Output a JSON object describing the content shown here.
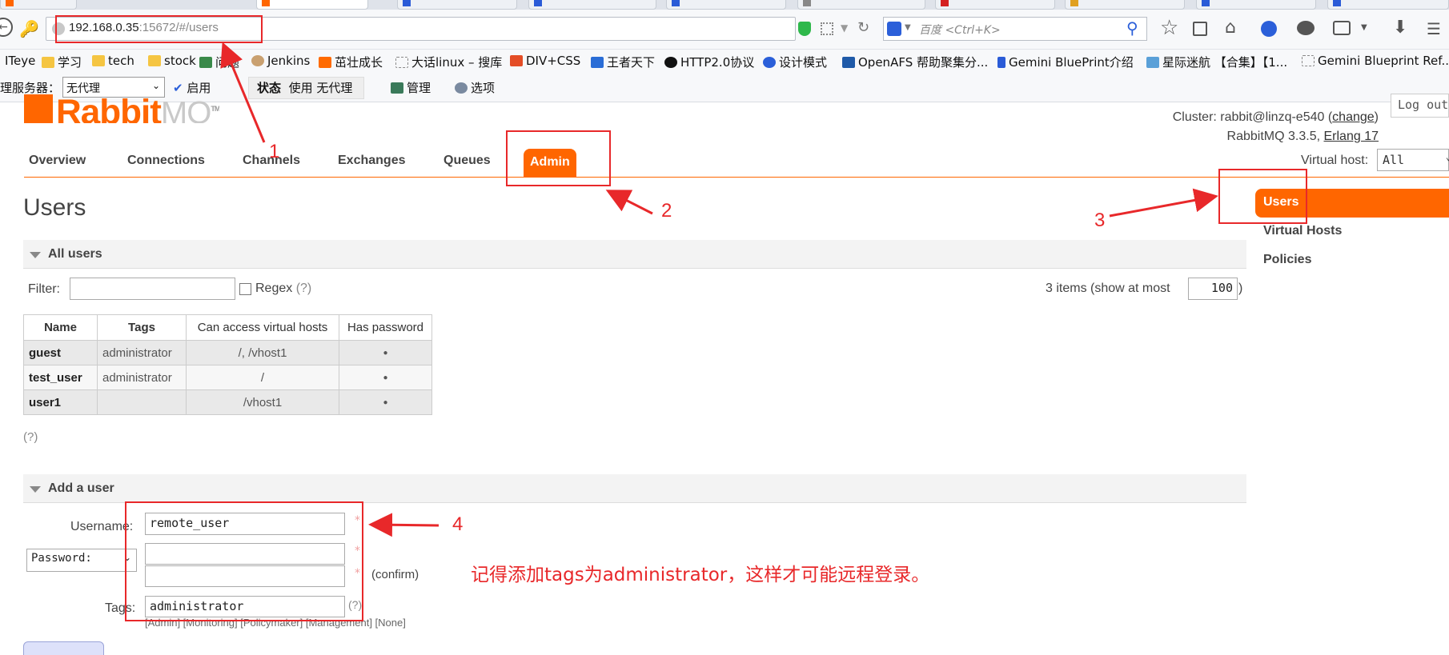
{
  "browser": {
    "url_host": "192.168.0.35",
    "url_rest": ":15672/#/users",
    "search_placeholder": "百度 <Ctrl+K>",
    "bookmarks": [
      "ITeye",
      "学习",
      "tech",
      "stock",
      "问题",
      "Jenkins",
      "茁壮成长",
      "大话linux – 搜库",
      "DIV+CSS",
      "王者天下",
      "HTTP2.0协议",
      "设计模式",
      "OpenAFS 帮助聚集分...",
      "Gemini BluePrint介绍",
      "星际迷航 【合集】【1...",
      "Gemini Blueprint Ref..."
    ],
    "proxy": {
      "label": "理服务器：",
      "value": "无代理",
      "enable": "启用",
      "status_label": "状态",
      "status_value": "使用 无代理",
      "manage": "管理",
      "options": "选项"
    }
  },
  "app": {
    "logo_main": "Rabbit",
    "logo_sub": "MQ",
    "logo_tm": "TM",
    "cluster_label": "Cluster:",
    "cluster_name": "rabbit@linzq-e540",
    "change": "change",
    "version": "RabbitMQ 3.3.5,",
    "erlang": "Erlang 17",
    "logout": "Log out",
    "vhost_label": "Virtual host:",
    "vhost_value": "All",
    "tabs": [
      "Overview",
      "Connections",
      "Channels",
      "Exchanges",
      "Queues",
      "Admin"
    ],
    "active_tab": "Admin",
    "page_title": "Users",
    "sidebar": [
      "Users",
      "Virtual Hosts",
      "Policies"
    ]
  },
  "all_users": {
    "title": "All users",
    "filter_label": "Filter:",
    "regex_label": "Regex",
    "regex_help": "(?)",
    "items_text": "3 items (show at most",
    "items_max": "100",
    "items_close": ")",
    "columns": [
      "Name",
      "Tags",
      "Can access virtual hosts",
      "Has password"
    ],
    "rows": [
      {
        "name": "guest",
        "tags": "administrator",
        "vhosts": "/, /vhost1",
        "pw": "●"
      },
      {
        "name": "test_user",
        "tags": "administrator",
        "vhosts": "/",
        "pw": "●"
      },
      {
        "name": "user1",
        "tags": "",
        "vhosts": "/vhost1",
        "pw": "●"
      }
    ],
    "help": "(?)"
  },
  "add_user": {
    "title": "Add a user",
    "username_label": "Username:",
    "username_value": "remote_user",
    "password_select": "Password:",
    "confirm": "(confirm)",
    "tags_label": "Tags:",
    "tags_value": "administrator",
    "tags_help": "(?)",
    "tag_hints": "[Admin] [Monitoring] [Policymaker] [Management] [None]",
    "required": "*"
  },
  "annotations": {
    "n1": "1",
    "n2": "2",
    "n3": "3",
    "n4": "4",
    "note": "记得添加tags为administrator，这样才可能远程登录。"
  },
  "colors": {
    "accent": "#ff6600",
    "annotation": "#e8282a"
  }
}
